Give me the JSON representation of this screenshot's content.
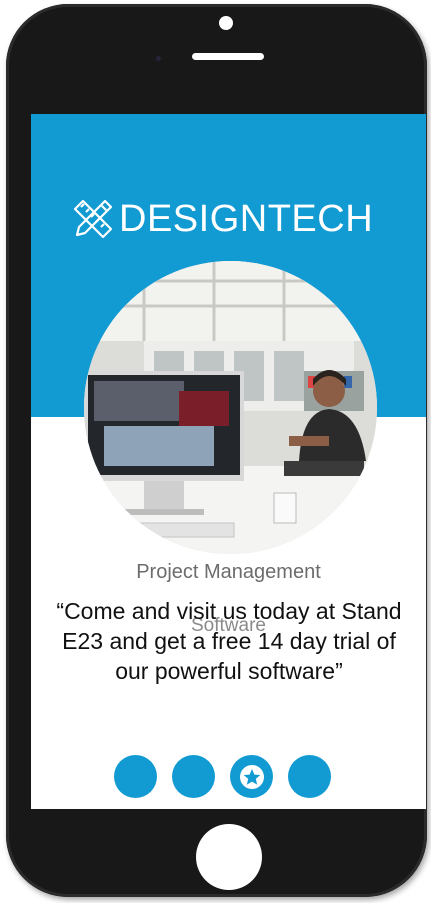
{
  "brand": {
    "name": "DESIGNTECH",
    "icon": "ruler-pencil-icon",
    "color": "#129bd3"
  },
  "hero_image": {
    "description_icon": "office-photo"
  },
  "product": {
    "line1": "Project Management",
    "line2": "Software"
  },
  "quote": "“Come and visit us today at Stand E23 and get a free 14 day trial of our powerful software”",
  "carousel": {
    "dot_count": 4,
    "active_index": 2,
    "active_icon": "star-icon",
    "color": "#129bd3"
  }
}
